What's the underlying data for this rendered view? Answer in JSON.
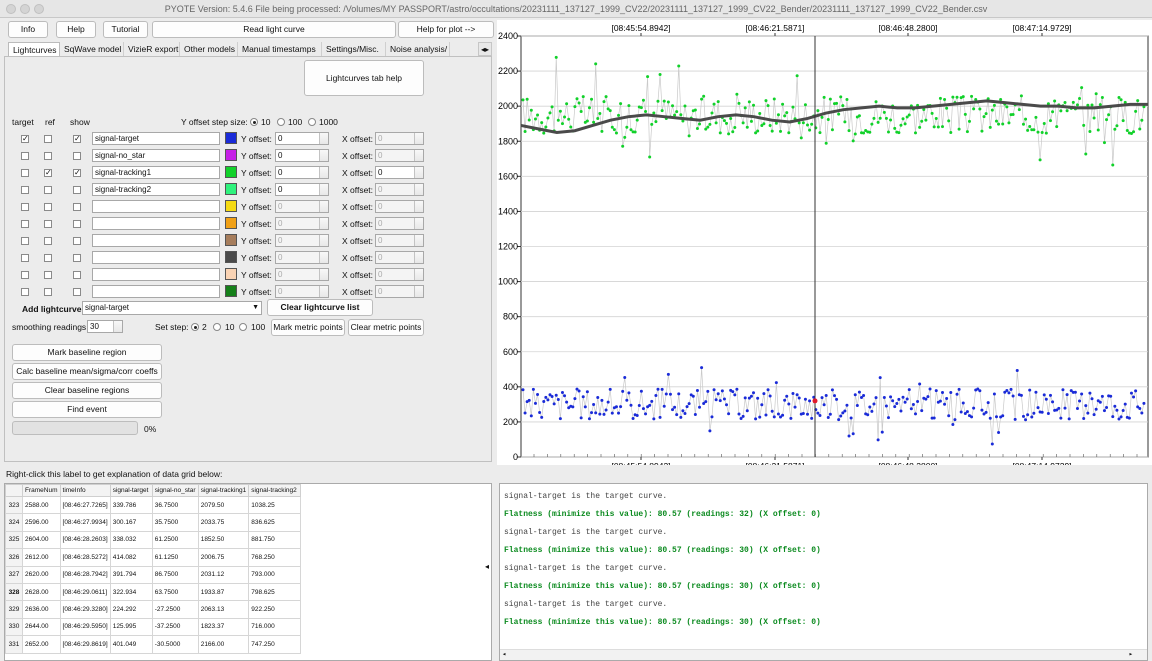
{
  "window": {
    "title": "PYOTE Version: 5.4.6  File being processed: /Volumes/MY PASSPORT/astro/occultations/20231111_137127_1999_CV22/20231111_137127_1999_CV22_Bender/20231111_137127_1999_CV22_Bender.csv"
  },
  "toolbar": {
    "info": "Info",
    "help": "Help",
    "tutorial": "Tutorial",
    "read": "Read light curve",
    "help_plot": "Help for plot -->"
  },
  "tabs": [
    "Lightcurves",
    "SqWave model",
    "VizieR export",
    "Other models",
    "Manual timestamps",
    "Settings/Misc.",
    "Noise analysis/"
  ],
  "lc_help": "Lightcurves tab help",
  "headers": {
    "target": "target",
    "ref": "ref",
    "show": "show"
  },
  "yoffset_step": {
    "label": "Y offset step size:",
    "options": [
      "10",
      "100",
      "1000"
    ]
  },
  "curves": [
    {
      "name": "signal-target",
      "color": "#1a2bd8",
      "target": true,
      "ref": false,
      "show": true,
      "yoff": "0",
      "xoff": "0",
      "yen": true,
      "xen": false
    },
    {
      "name": "signal-no_star",
      "color": "#c61ee6",
      "target": false,
      "ref": false,
      "show": false,
      "yoff": "0",
      "xoff": "0",
      "yen": true,
      "xen": false
    },
    {
      "name": "signal-tracking1",
      "color": "#11d12a",
      "target": false,
      "ref": true,
      "show": true,
      "yoff": "0",
      "xoff": "0",
      "yen": true,
      "xen": true
    },
    {
      "name": "signal-tracking2",
      "color": "#2ff27d",
      "target": false,
      "ref": false,
      "show": false,
      "yoff": "0",
      "xoff": "0",
      "yen": true,
      "xen": false
    },
    {
      "name": "",
      "color": "#f5da13",
      "target": false,
      "ref": false,
      "show": false,
      "yoff": "0",
      "xoff": "0",
      "yen": false,
      "xen": false
    },
    {
      "name": "",
      "color": "#f0a016",
      "target": false,
      "ref": false,
      "show": false,
      "yoff": "0",
      "xoff": "0",
      "yen": false,
      "xen": false
    },
    {
      "name": "",
      "color": "#a67d5c",
      "target": false,
      "ref": false,
      "show": false,
      "yoff": "0",
      "xoff": "0",
      "yen": false,
      "xen": false
    },
    {
      "name": "",
      "color": "#4a4a4a",
      "target": false,
      "ref": false,
      "show": false,
      "yoff": "0",
      "xoff": "0",
      "yen": false,
      "xen": false
    },
    {
      "name": "",
      "color": "#f9d3b4",
      "target": false,
      "ref": false,
      "show": false,
      "yoff": "0",
      "xoff": "0",
      "yen": false,
      "xen": false
    },
    {
      "name": "",
      "color": "#15801a",
      "target": false,
      "ref": false,
      "show": false,
      "yoff": "0",
      "xoff": "0",
      "yen": false,
      "xen": false
    }
  ],
  "yoff_label": "Y offset:",
  "xoff_label": "X offset:",
  "add_lc": {
    "label": "Add lightcurve",
    "value": "signal-target"
  },
  "clear_list": "Clear lightcurve list",
  "smoothing": {
    "label": "smoothing readings",
    "value": "30"
  },
  "set_step": {
    "label": "Set step:",
    "options": [
      "2",
      "10",
      "100"
    ]
  },
  "mark_metric": "Mark metric points",
  "clear_metric": "Clear metric points",
  "mark_baseline": "Mark baseline region",
  "calc_baseline": "Calc baseline mean/sigma/corr coeffs",
  "clear_baseline": "Clear baseline regions",
  "find_event": "Find event",
  "progress": {
    "value": 0,
    "label": "0%"
  },
  "grid_label": "Right-click this label to get explanation of data grid below:",
  "grid": {
    "columns": [
      "FrameNum",
      "timeInfo",
      "signal-target",
      "signal-no_star",
      "signal-tracking1",
      "signal-tracking2"
    ],
    "rows": [
      {
        "n": "323",
        "c": [
          "2588.00",
          "[08:46:27.7265]",
          "339.786",
          "36.7500",
          "2079.50",
          "1038.25"
        ]
      },
      {
        "n": "324",
        "c": [
          "2596.00",
          "[08:46:27.9934]",
          "300.167",
          "35.7500",
          "2033.75",
          "836.625"
        ]
      },
      {
        "n": "325",
        "c": [
          "2604.00",
          "[08:46:28.2603]",
          "338.032",
          "61.2500",
          "1852.50",
          "881.750"
        ]
      },
      {
        "n": "326",
        "c": [
          "2612.00",
          "[08:46:28.5272]",
          "414.082",
          "61.1250",
          "2006.75",
          "768.250"
        ]
      },
      {
        "n": "327",
        "c": [
          "2620.00",
          "[08:46:28.7942]",
          "391.794",
          "86.7500",
          "2031.12",
          "793.000"
        ]
      },
      {
        "n": "328",
        "c": [
          "2628.00",
          "[08:46:29.0611]",
          "322.934",
          "63.7500",
          "1933.87",
          "798.625"
        ]
      },
      {
        "n": "329",
        "c": [
          "2636.00",
          "[08:46:29.3280]",
          "224.292",
          "-27.2500",
          "2063.13",
          "922.250"
        ]
      },
      {
        "n": "330",
        "c": [
          "2644.00",
          "[08:46:29.5950]",
          "125.995",
          "-37.2500",
          "1823.37",
          "716.000"
        ]
      },
      {
        "n": "331",
        "c": [
          "2652.00",
          "[08:46:29.8619]",
          "401.049",
          "-30.5000",
          "2166.00",
          "747.250"
        ]
      }
    ]
  },
  "log": [
    {
      "text": "signal-target is the target curve.",
      "green": false
    },
    {
      "text": "Flatness (minimize this value): 80.57 (readings: 32) (X offset: 0)",
      "green": true
    },
    {
      "text": "signal-target is the target curve.",
      "green": false
    },
    {
      "text": "Flatness (minimize this value): 80.57 (readings: 30) (X offset: 0)",
      "green": true
    },
    {
      "text": "signal-target is the target curve.",
      "green": false
    },
    {
      "text": "Flatness (minimize this value): 80.57 (readings: 30) (X offset: 0)",
      "green": true
    },
    {
      "text": "signal-target is the target curve.",
      "green": false
    },
    {
      "text": "Flatness (minimize this value): 80.57 (readings: 30) (X offset: 0)",
      "green": true
    }
  ],
  "plot": {
    "y_ticks": [
      "0",
      "200",
      "400",
      "600",
      "800",
      "1000",
      "1200",
      "1400",
      "1600",
      "1800",
      "2000",
      "2200",
      "2400"
    ],
    "x_ticks": [
      "[08:45:54.8942]",
      "[08:46:21.5871]",
      "[08:46:48.2800]",
      "[08:47:14.9729]"
    ],
    "colors": {
      "target": "#1a2bd8",
      "ref": "#11d12a",
      "smooth": "#4a4a4a",
      "cursor": "#e0192b"
    }
  },
  "chart_data": {
    "type": "scatter",
    "ylim": [
      0,
      2400
    ],
    "y_ticks": [
      0,
      200,
      400,
      600,
      800,
      1000,
      1200,
      1400,
      1600,
      1800,
      2000,
      2200,
      2400
    ],
    "x_ticks": [
      "[08:45:54.8942]",
      "[08:46:21.5871]",
      "[08:46:48.2800]",
      "[08:47:14.9729]"
    ],
    "series": [
      {
        "name": "signal-target",
        "color": "#1a2bd8",
        "baseline": 300,
        "range": [
          80,
          590
        ]
      },
      {
        "name": "signal-tracking1",
        "color": "#11d12a",
        "baseline": 1950,
        "range": [
          1530,
          2330
        ]
      },
      {
        "name": "smoothed",
        "color": "#4a4a4a",
        "values": [
          1890,
          1870,
          1850,
          1860,
          1890,
          1920,
          1940,
          1950,
          1940,
          1930,
          1920,
          1940,
          1950,
          1940,
          1920,
          1910,
          1930,
          1960,
          1980,
          1990,
          2000,
          1990,
          1990,
          2000,
          2010,
          2020,
          2030,
          2020,
          2010,
          2000,
          2000,
          1990,
          1990,
          2000,
          2010,
          2010
        ]
      }
    ],
    "cursor_value": 320
  }
}
